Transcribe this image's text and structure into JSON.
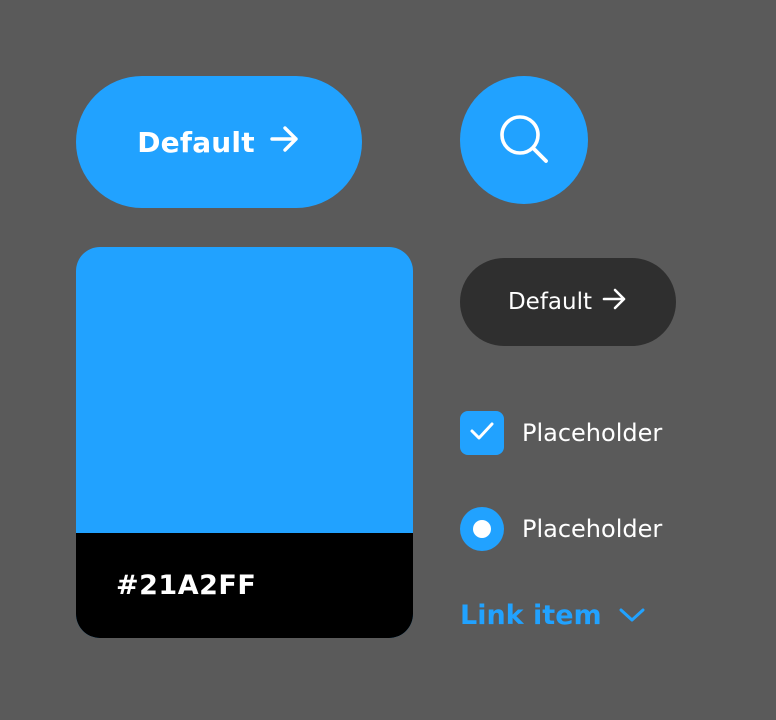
{
  "colors": {
    "background": "#5a5a5a",
    "primary": "#21A2FF",
    "dark_button": "#2f2f2f",
    "swatch_footer": "#000000",
    "text_on_color": "#ffffff"
  },
  "primary_button": {
    "label": "Default",
    "icon": "arrow-right-icon"
  },
  "search_button": {
    "icon": "search-icon"
  },
  "swatch": {
    "hex": "#21A2FF"
  },
  "dark_button": {
    "label": "Default",
    "icon": "arrow-right-icon"
  },
  "checkbox": {
    "label": "Placeholder",
    "checked": true
  },
  "radio": {
    "label": "Placeholder",
    "selected": true
  },
  "link": {
    "label": "Link item",
    "icon": "chevron-down-icon"
  }
}
